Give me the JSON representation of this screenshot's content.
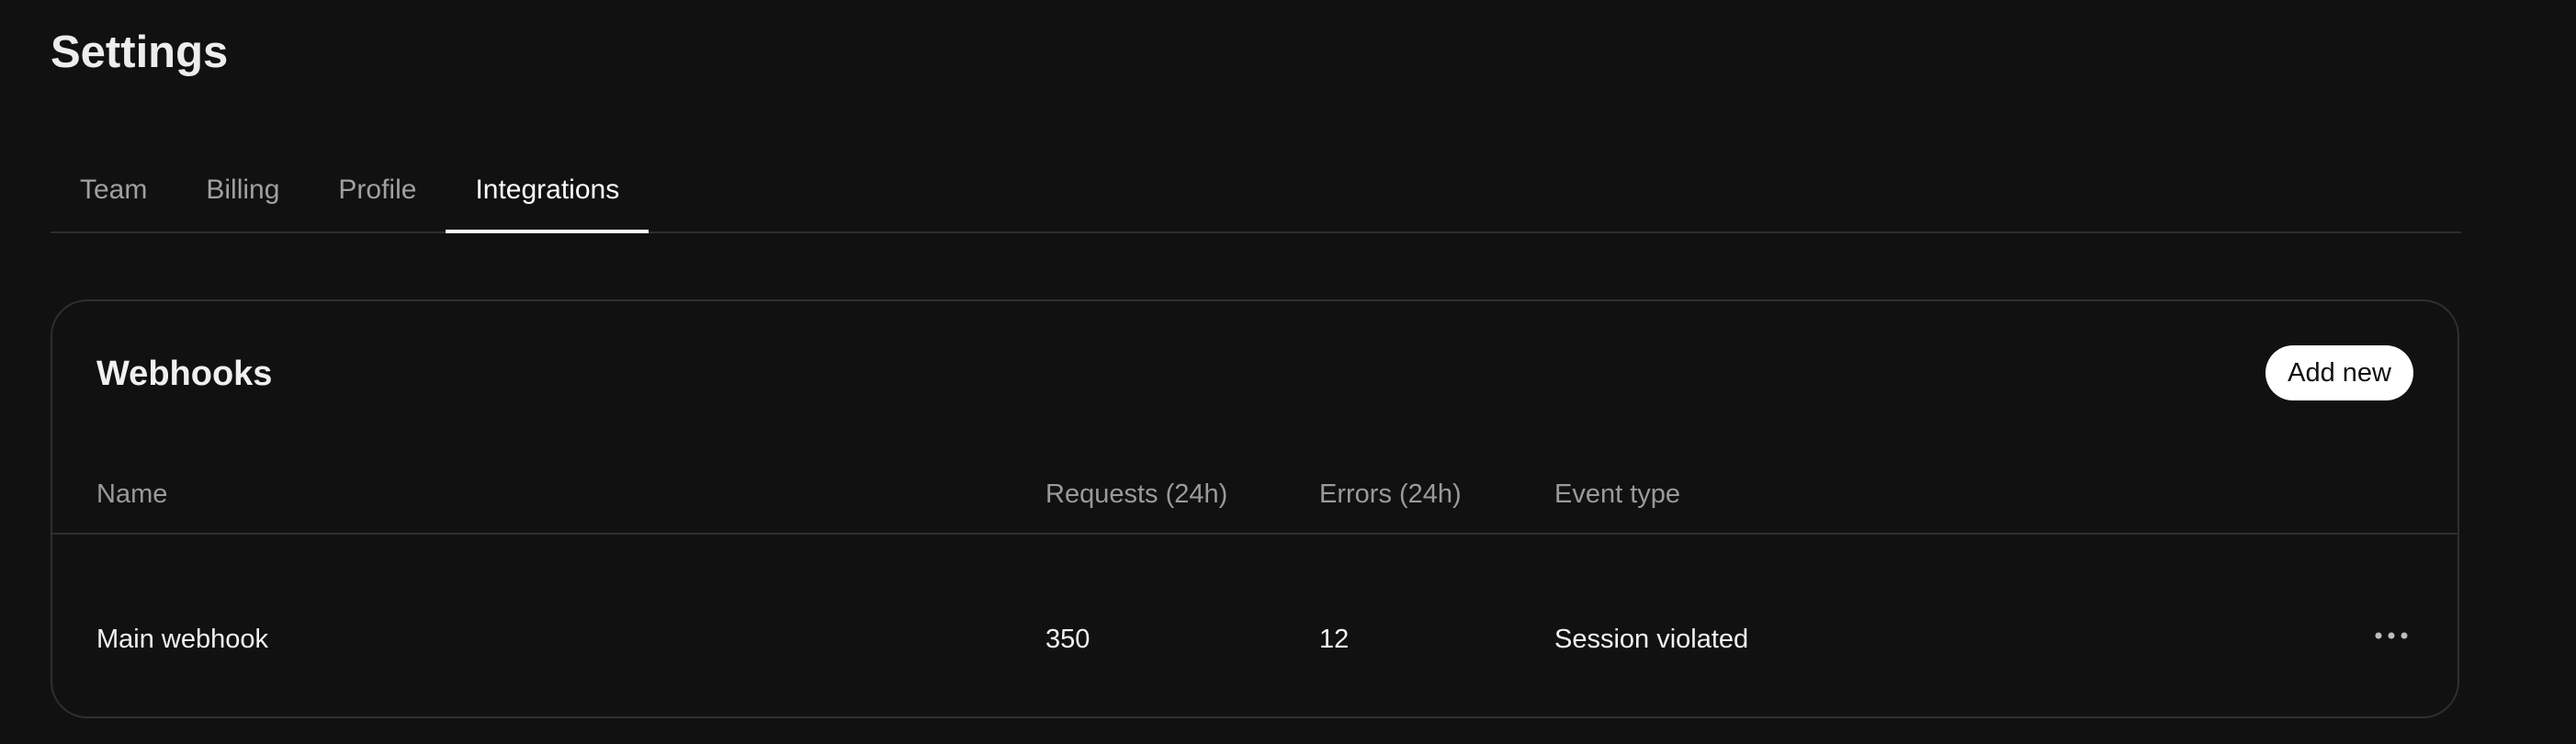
{
  "page": {
    "title": "Settings"
  },
  "tabs": [
    {
      "label": "Team",
      "active": false
    },
    {
      "label": "Billing",
      "active": false
    },
    {
      "label": "Profile",
      "active": false
    },
    {
      "label": "Integrations",
      "active": true
    }
  ],
  "webhooks": {
    "title": "Webhooks",
    "add_label": "Add new",
    "columns": {
      "name": "Name",
      "requests": "Requests (24h)",
      "errors": "Errors (24h)",
      "event_type": "Event type"
    },
    "rows": [
      {
        "name": "Main webhook",
        "requests": "350",
        "errors": "12",
        "event_type": "Session violated",
        "actions_icon": "more-horizontal-icon"
      }
    ]
  },
  "colors": {
    "background": "#111111",
    "accent": "#ffffff",
    "border": "#2f2f2f",
    "muted_text": "#9a9a9a"
  }
}
